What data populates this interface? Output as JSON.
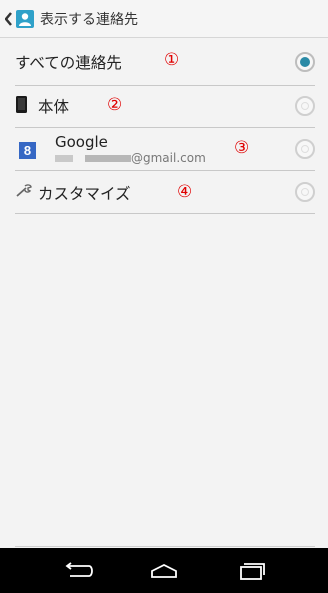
{
  "header": {
    "title": "表示する連絡先"
  },
  "options": [
    {
      "label": "すべての連絡先",
      "number": "①",
      "selected": true
    },
    {
      "label": "本体",
      "number": "②",
      "selected": false
    },
    {
      "label": "Google",
      "account": "@gmail.com",
      "badge": "8",
      "number": "③",
      "selected": false
    },
    {
      "label": "カスタマイズ",
      "number": "④",
      "selected": false
    }
  ],
  "icons": {
    "up": "chevron-left-icon",
    "app": "contacts-icon",
    "device": "phone-icon",
    "google": "google-icon",
    "customize": "wrench-icon",
    "back": "back-icon",
    "home": "home-icon",
    "recents": "recent-apps-icon"
  },
  "colors": {
    "accent": "#2fa1c9",
    "radio_selected": "#2a8aa6",
    "annotation": "#e00000"
  }
}
